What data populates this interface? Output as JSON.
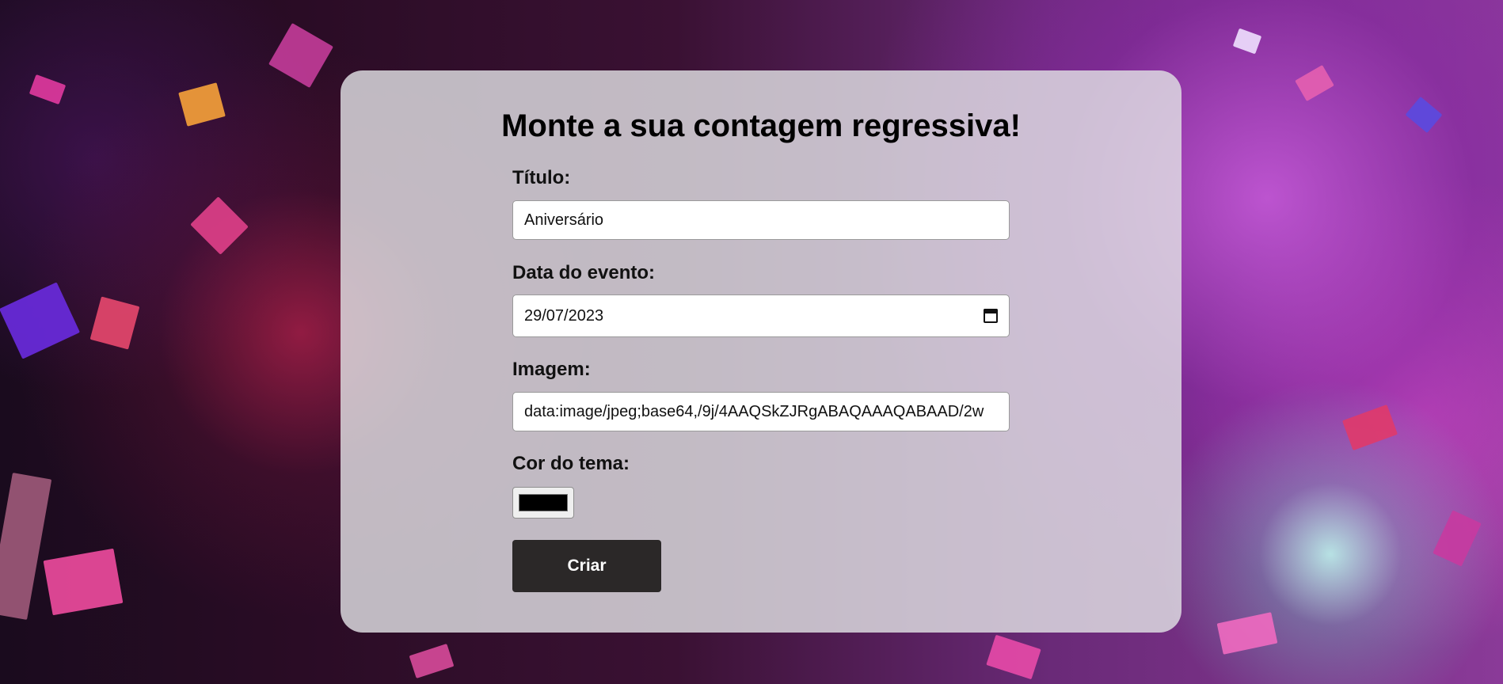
{
  "page": {
    "heading": "Monte a sua contagem regressiva!"
  },
  "form": {
    "title_label": "Título:",
    "title_value": "Aniversário",
    "date_label": "Data do evento:",
    "date_value": "29/07/2023",
    "image_label": "Imagem:",
    "image_value": "data:image/jpeg;base64,/9j/4AAQSkZJRgABAQAAAQABAAD/2w",
    "color_label": "Cor do tema:",
    "color_value": "#000000",
    "submit_label": "Criar"
  },
  "icons": {
    "date_picker": "calendar-icon"
  },
  "colors": {
    "card_background": "#e1e1e4",
    "button_background": "#2b2828",
    "button_text": "#ffffff"
  }
}
